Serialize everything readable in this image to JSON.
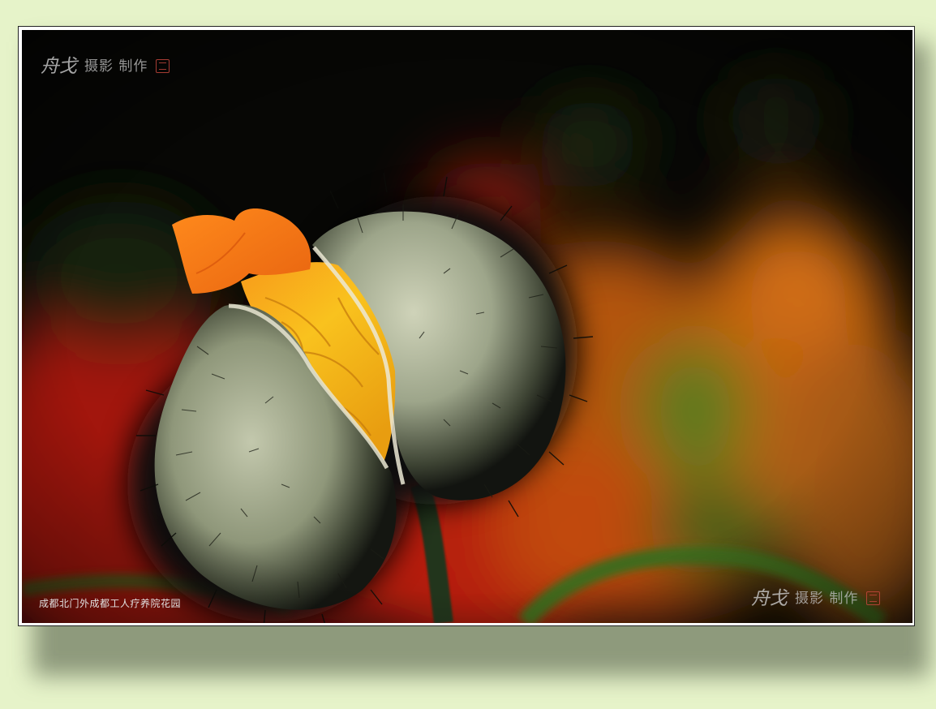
{
  "photo": {
    "subject": "poppy bud opening, orange-yellow petals emerging from hairy green sepals",
    "caption": "成都北门外成都工人疗养院花园"
  },
  "watermark": {
    "signature": "舟戈",
    "credit": "摄影 制作"
  },
  "colors": {
    "page_background": "#e6f3c9",
    "frame_border": "#ffffff",
    "photo_background": "#070705",
    "petal_orange": "#f27a14",
    "petal_yellow": "#f9c11c",
    "sepal_green": "#a3ab8f"
  }
}
